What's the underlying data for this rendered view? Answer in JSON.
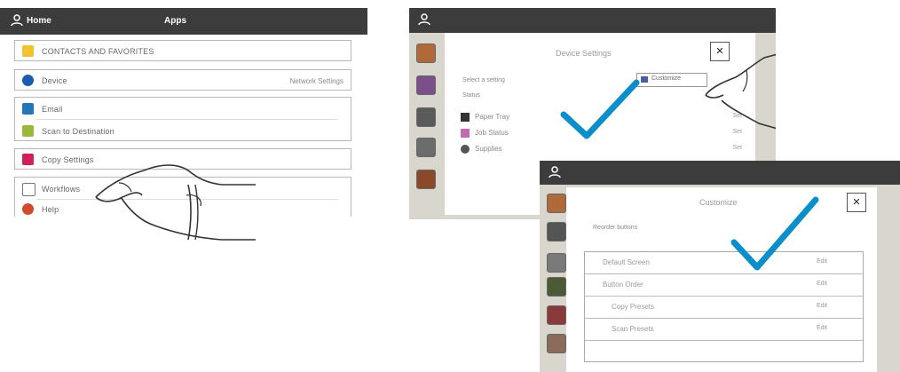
{
  "panel_a": {
    "header": {
      "user_label": "Home",
      "title": "Apps"
    },
    "rows": [
      {
        "label": "CONTACTS AND FAVORITES",
        "value": "",
        "icon": "folder-icon",
        "color": "#f2c32e"
      },
      {
        "label": "Device",
        "value": "Network Settings",
        "icon": "device-icon",
        "color": "#1e5ab0"
      },
      {
        "label": "Email",
        "value": "",
        "icon": "email-icon",
        "color": "#2178b8"
      },
      {
        "label": "Scan to Destination",
        "value": "",
        "icon": "scan-icon",
        "color": "#9ab93a"
      },
      {
        "label": "Copy Settings",
        "value": "",
        "icon": "copy-icon",
        "color": "#d0215a"
      },
      {
        "label": "Workflows",
        "value": "",
        "icon": "workflow-icon",
        "color": "#888888"
      },
      {
        "label": "Help",
        "value": "",
        "icon": "help-icon",
        "color": "#d14a2b"
      }
    ]
  },
  "panel_b": {
    "dialog_title": "Device Settings",
    "subtitle": "Select a setting",
    "section": "Status",
    "action_label": "Customize",
    "close_label": "×",
    "rows": [
      {
        "label": "Paper Tray",
        "value": "Set",
        "color": "#333333"
      },
      {
        "label": "Job Status",
        "value": "Set",
        "color": "#c36bb0"
      },
      {
        "label": "Supplies",
        "value": "Set",
        "color": "#555555"
      }
    ]
  },
  "panel_c": {
    "dialog_title": "Customize",
    "subtitle": "Reorder buttons",
    "close_label": "×",
    "rows": [
      {
        "label": "Default Screen",
        "value": "Edit"
      },
      {
        "label": "Button Order",
        "value": "Edit"
      },
      {
        "label": "Copy Presets",
        "value": "Edit"
      },
      {
        "label": "Scan Presets",
        "value": "Edit"
      }
    ]
  },
  "colors": {
    "checkmark": "#0b8ec9",
    "header": "#3c3c3c"
  }
}
